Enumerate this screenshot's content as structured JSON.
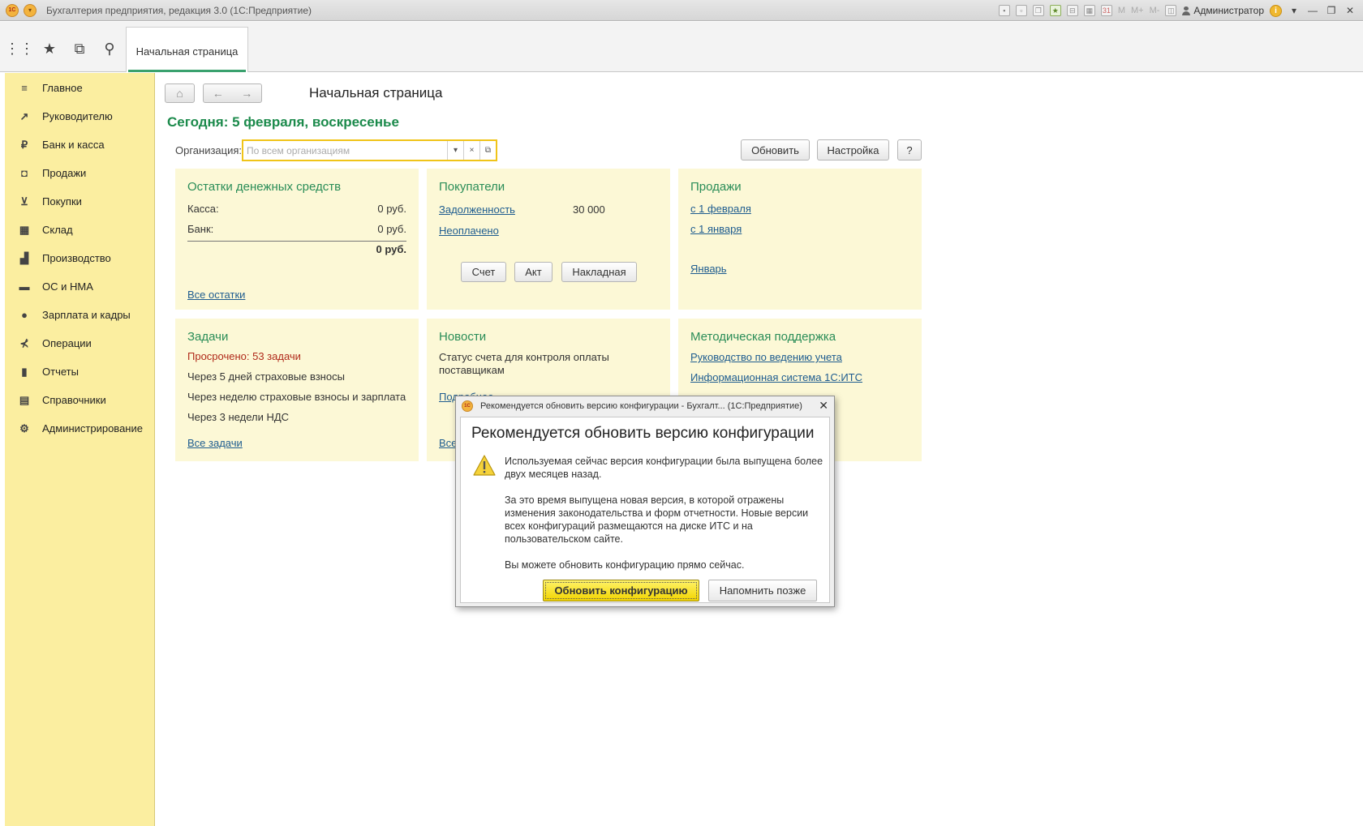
{
  "window": {
    "title": "Бухгалтерия предприятия, редакция 3.0  (1С:Предприятие)",
    "logo": "1С",
    "user": "Администратор",
    "toolbar_icons": [
      "save-icon",
      "print-icon",
      "copy-icon",
      "favorites-add-icon",
      "bookmark-icon",
      "calculator-icon",
      "calendar-icon",
      "memory-icon",
      "panel-layout-icon"
    ],
    "memory_labels": [
      "M",
      "M+",
      "M-"
    ]
  },
  "toppanel": {
    "icons": [
      "apps-grid-icon",
      "star-icon",
      "history-icon",
      "search-icon"
    ],
    "tab": "Начальная страница"
  },
  "sidebar": {
    "items": [
      {
        "label": "Главное",
        "icon": "menu-lines-icon",
        "glyph": "≡"
      },
      {
        "label": "Руководителю",
        "icon": "trend-icon",
        "glyph": "↗"
      },
      {
        "label": "Банк и касса",
        "icon": "ruble-coin-icon",
        "glyph": "₽"
      },
      {
        "label": "Продажи",
        "icon": "shopping-bag-icon",
        "glyph": "◘"
      },
      {
        "label": "Покупки",
        "icon": "cart-icon",
        "glyph": "⊻"
      },
      {
        "label": "Склад",
        "icon": "warehouse-icon",
        "glyph": "▦"
      },
      {
        "label": "Производство",
        "icon": "factory-icon",
        "glyph": "▟"
      },
      {
        "label": "ОС и НМА",
        "icon": "truck-icon",
        "glyph": "▬"
      },
      {
        "label": "Зарплата и кадры",
        "icon": "person-icon",
        "glyph": "●"
      },
      {
        "label": "Операции",
        "icon": "operations-icon",
        "glyph": "⊀"
      },
      {
        "label": "Отчеты",
        "icon": "bar-chart-icon",
        "glyph": "▮"
      },
      {
        "label": "Справочники",
        "icon": "books-icon",
        "glyph": "▤"
      },
      {
        "label": "Администрирование",
        "icon": "gear-icon",
        "glyph": "⚙"
      }
    ]
  },
  "page": {
    "title": "Начальная страница",
    "today": "Сегодня: 5 февраля, воскресенье",
    "org_label": "Организация:",
    "org_placeholder": "По всем организациям",
    "refresh": "Обновить",
    "settings": "Настройка",
    "help": "?"
  },
  "panels": {
    "cash": {
      "title": "Остатки денежных средств",
      "kassa_label": "Касса:",
      "kassa_value": "0 руб.",
      "bank_label": "Банк:",
      "bank_value": "0 руб.",
      "total": "0 руб.",
      "link": "Все остатки"
    },
    "buyers": {
      "title": "Покупатели",
      "debt_link": "Задолженность",
      "debt_value": "30 000",
      "unpaid_link": "Неоплачено",
      "btn_invoice": "Счет",
      "btn_act": "Акт",
      "btn_waybill": "Накладная"
    },
    "sales": {
      "title": "Продажи",
      "link1": "с 1 февраля",
      "link2": "с 1 января",
      "link3": "Январь"
    },
    "tasks": {
      "title": "Задачи",
      "overdue": "Просрочено: 53 задачи",
      "item1": "Через 5 дней страховые взносы",
      "item2": "Через неделю страховые взносы и зарплата",
      "item3": "Через 3 недели НДС",
      "link": "Все задачи"
    },
    "news": {
      "title": "Новости",
      "text": "Статус счета для контроля оплаты поставщикам",
      "more_link": "Подробнее",
      "all_link": "Все"
    },
    "support": {
      "title": "Методическая поддержка",
      "link1": "Руководство по ведению учета",
      "link2": "Информационная система 1С:ИТС"
    }
  },
  "dialog": {
    "window_title": "Рекомендуется обновить версию конфигурации - Бухгалт...  (1С:Предприятие)",
    "heading": "Рекомендуется обновить версию конфигурации",
    "para1": "Используемая сейчас версия конфигурации была выпущена более двух месяцев назад.",
    "para2": "За это время выпущена новая версия, в которой отражены изменения законодательства и форм отчетности. Новые версии всех конфигураций размещаются на диске ИТС и на пользовательском сайте.",
    "para3": "Вы можете обновить конфигурацию прямо сейчас.",
    "btn_update": "Обновить конфигурацию",
    "btn_later": "Напомнить позже"
  }
}
